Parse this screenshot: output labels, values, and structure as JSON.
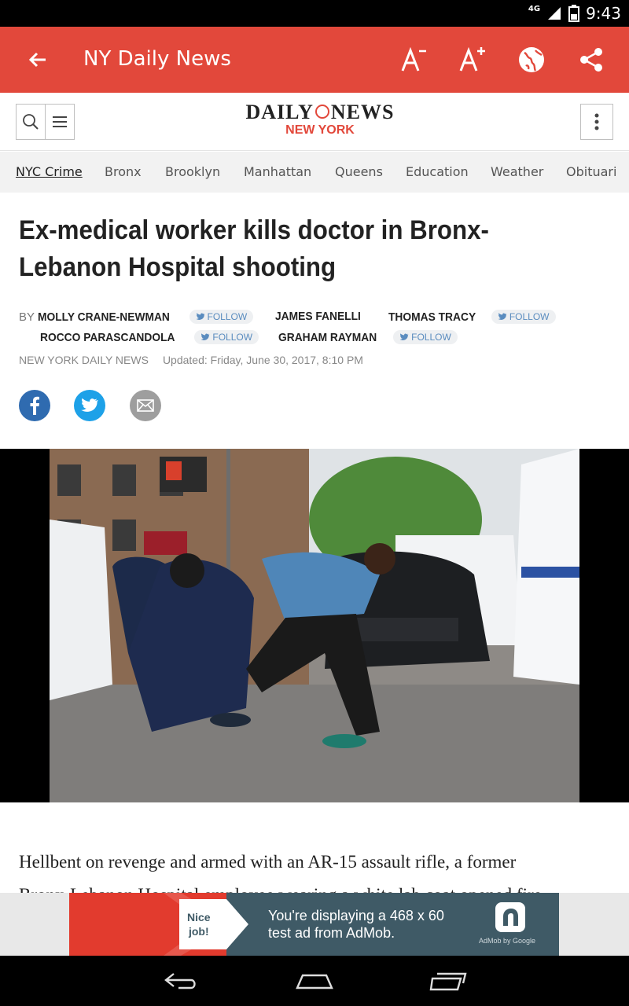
{
  "status_bar": {
    "network": "4G",
    "time": "9:43"
  },
  "app_bar": {
    "title": "NY Daily News",
    "actions": [
      "decrease-font",
      "increase-font",
      "open-in-browser",
      "share"
    ],
    "color": "#e2483b"
  },
  "masthead": {
    "logo_line1_left": "DAILY",
    "logo_line1_right": "NEWS",
    "logo_line2": "NEW YORK"
  },
  "sections": [
    "NYC Crime",
    "Bronx",
    "Brooklyn",
    "Manhattan",
    "Queens",
    "Education",
    "Weather",
    "Obituari"
  ],
  "article": {
    "headline": "Ex-medical worker kills doctor in Bronx-Lebanon Hospital shooting",
    "by_label": "BY",
    "follow_label": "FOLLOW",
    "authors": [
      {
        "name": "Molly Crane-Newman",
        "follow": true
      },
      {
        "name": "James Fanelli",
        "follow": false
      },
      {
        "name": "Thomas Tracy",
        "follow": true
      },
      {
        "name": "Rocco Parascandola",
        "follow": true
      },
      {
        "name": "Graham Rayman",
        "follow": true
      }
    ],
    "source": "NEW YORK DAILY NEWS",
    "updated": "Updated: Friday, June 30, 2017, 8:10 PM",
    "share": [
      "facebook",
      "twitter",
      "email"
    ],
    "body_line1": "Hellbent on revenge and armed with an AR-15 assault rifle, a former",
    "body_line2": "Bronx-Lebanon Hospital employee wearing a white lab coat opened fire"
  },
  "ad": {
    "badge_line1": "Nice",
    "badge_line2": "job!",
    "message_line1": "You're displaying a 468 x 60",
    "message_line2": "test ad from AdMob.",
    "attribution": "AdMob by Google"
  },
  "nav_bar": [
    "back",
    "home",
    "recents"
  ]
}
